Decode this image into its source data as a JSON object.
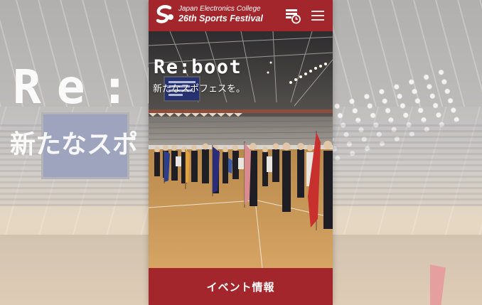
{
  "header": {
    "logo_line1": "Japan Electronics College",
    "logo_line2": "26th Sports Festival",
    "schedule_icon": "schedule-clock-icon",
    "menu_icon": "hamburger-menu-icon"
  },
  "hero": {
    "title": "Re:boot",
    "subtitle": "新たなスポフェスを。"
  },
  "cta": {
    "label": "イベント情報"
  },
  "background": {
    "title_fragment": "Re:b",
    "subtitle_fragment": "新たなスポ"
  },
  "colors": {
    "brand_red": "#a3262c",
    "text_white": "#ffffff"
  }
}
